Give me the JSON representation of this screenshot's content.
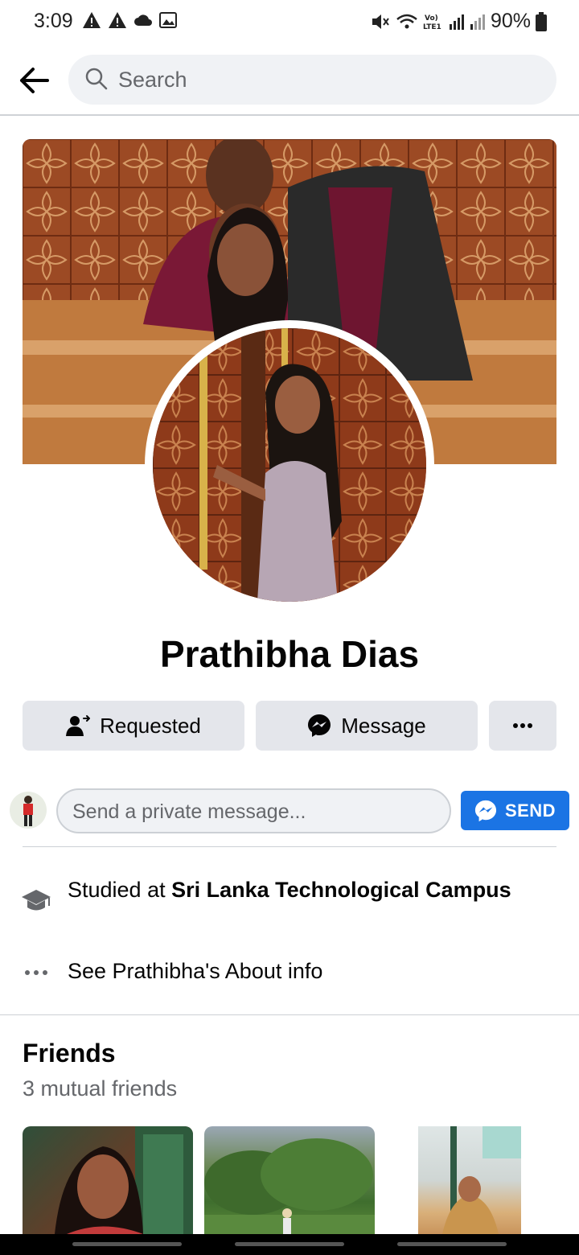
{
  "status_bar": {
    "time": "3:09",
    "battery_text": "90%"
  },
  "search": {
    "placeholder": "Search"
  },
  "profile": {
    "name": "Prathibha Dias"
  },
  "actions": {
    "requested_label": "Requested",
    "message_label": "Message"
  },
  "private_message": {
    "placeholder": "Send a private message...",
    "send_label": "SEND"
  },
  "intro": {
    "studied_prefix": "Studied at ",
    "school": "Sri Lanka Technological Campus",
    "about_link": "See Prathibha's About info"
  },
  "friends": {
    "title": "Friends",
    "subtitle": "3 mutual friends"
  },
  "colors": {
    "accent": "#1b74e4",
    "button_bg": "#e4e6eb",
    "search_bg": "#f0f2f5"
  }
}
